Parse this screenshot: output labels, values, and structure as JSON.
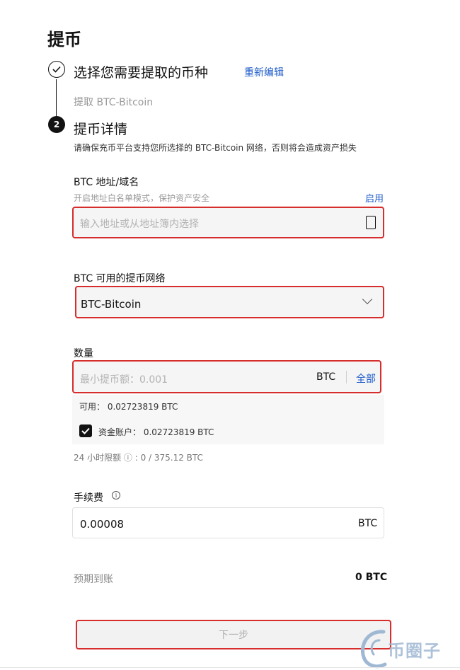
{
  "page": {
    "title": "提币"
  },
  "step1": {
    "title": "选择您需要提取的币种",
    "edit_label": "重新编辑",
    "subtitle": "提取 BTC-Bitcoin"
  },
  "step2": {
    "number": "2",
    "title": "提币详情",
    "description": "请确保充币平台支持您所选择的 BTC-Bitcoin 网络，否则将会造成资产损失"
  },
  "address": {
    "label": "BTC 地址/域名",
    "hint": "开启地址白名单模式，保护资产安全",
    "enable_label": "启用",
    "placeholder": "输入地址或从地址簿内选择"
  },
  "network": {
    "label": "BTC 可用的提币网络",
    "selected": "BTC-Bitcoin"
  },
  "amount": {
    "label": "数量",
    "placeholder": "最小提币额：0.001",
    "unit": "BTC",
    "all_label": "全部",
    "available": "可用： 0.02723819 BTC",
    "fund_account": "资金账户： 0.02723819 BTC",
    "fund_checked": true
  },
  "limit": {
    "text": "24 小时限额 ⓘ : 0 / 375.12 BTC"
  },
  "fee": {
    "label": "手续费",
    "value": "0.00008",
    "unit": "BTC"
  },
  "expected": {
    "label": "预期到账",
    "value": "0 BTC"
  },
  "next_button": {
    "label": "下一步"
  },
  "watermark": {
    "text": "币圈子"
  },
  "colors": {
    "accent": "#1c5ac9",
    "highlight": "#d62d2d",
    "text": "#121212"
  }
}
